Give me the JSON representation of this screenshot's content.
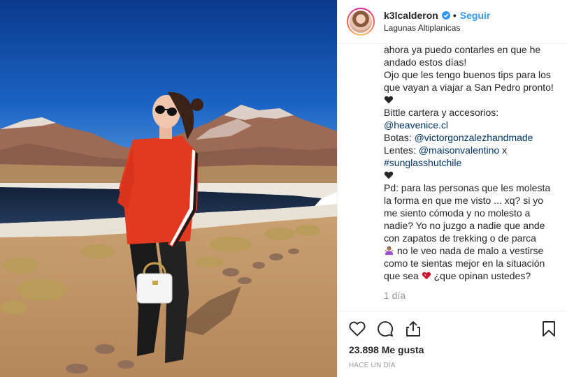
{
  "post": {
    "username": "k3lcalderon",
    "separator": "•",
    "follow_label": "Seguir",
    "location": "Lagunas Altiplanicas",
    "caption": {
      "line1": "ahora ya puedo contarles en que he",
      "line2": "andado estos días!",
      "line3": "Ojo que les tengo buenos tips para los",
      "line4": "que vayan a viajar a San Pedro pronto!",
      "line6": "Bittle cartera y accesorios:",
      "link_heavenice": "@heavenice.cl",
      "botas_label": "Botas: ",
      "link_botas": "@victorgonzalezhandmade",
      "lentes_label": "Lentes: ",
      "link_lentes": "@maisonvalentino",
      "x_word": " x",
      "link_hashtag": "#sunglasshutchile",
      "pd1": "Pd: para las personas que les molesta",
      "pd2": "la forma en que me visto ... xq? si yo",
      "pd3": "me siento cómoda y no molesto a",
      "pd4": "nadie? Yo no juzgo a nadie que ande",
      "pd5": "con zapatos de trekking o de parca",
      "pd6": " no le veo nada de malo a vestirse",
      "pd7": "como te sientas mejor en la situación",
      "pd8a": "que sea ",
      "pd8b": " ¿que opinan ustedes?"
    },
    "caption_time": "1 día",
    "likes": "23.898 Me gusta",
    "time_ago": "HACE UN DÍA"
  },
  "icons": {
    "verified": "verified-badge-icon",
    "like": "heart-outline-icon",
    "comment": "comment-bubble-icon",
    "share": "share-upload-icon",
    "save": "bookmark-icon"
  },
  "colors": {
    "accent_blue": "#3897f0",
    "link_blue": "#003569",
    "muted": "#999999",
    "text": "#262626"
  }
}
